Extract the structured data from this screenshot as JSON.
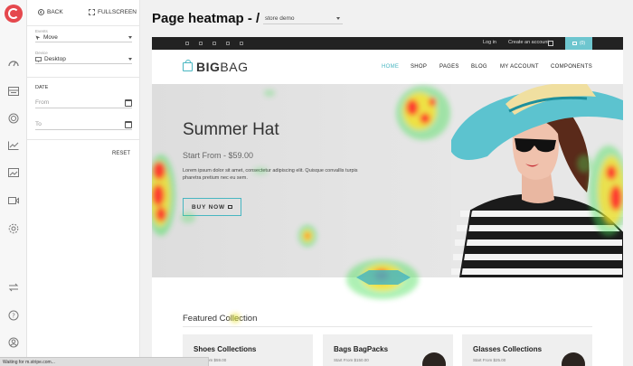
{
  "panel": {
    "back_label": "BACK",
    "fullscreen_label": "FULLSCREEN",
    "events": {
      "label": "Events",
      "value": "Move"
    },
    "device": {
      "label": "Device",
      "value": "Desktop"
    },
    "date_title": "DATE",
    "from_placeholder": "From",
    "to_placeholder": "To",
    "reset_label": "RESET"
  },
  "main": {
    "title": "Page heatmap - /",
    "page_select": "store demo"
  },
  "site": {
    "login": "Log in",
    "create_account": "Create an account",
    "cart_count": "(0)",
    "brand_bold": "BIG",
    "brand_rest": "BAG",
    "menu": [
      "HOME",
      "SHOP",
      "PAGES",
      "BLOG",
      "MY ACCOUNT",
      "COMPONENTS"
    ],
    "hero": {
      "title": "Summer Hat",
      "price": "Start From - $59.00",
      "desc": "Lorem ipsum dolor sit amet, consectetur adipiscing elit. Quisque convallis turpis pharetra pretium nec eu sem.",
      "button": "BUY NOW"
    },
    "featured": "Featured Collection",
    "cards": [
      {
        "title": "Shoes Collections",
        "price": "Start From $59.00"
      },
      {
        "title": "Bags BagPacks",
        "price": "Start From $150.00"
      },
      {
        "title": "Glasses Collections",
        "price": "Start From $25.00"
      }
    ]
  },
  "status": "Waiting for m.stripe.com...",
  "colors": {
    "accent": "#48b6c1",
    "brand_red": "#e5484d",
    "heat_hot": "#ff2a1a",
    "heat_warm": "#ffe020",
    "heat_cool": "#49e05a"
  },
  "icons": {
    "rail": [
      "dashboard-icon",
      "recordings-icon",
      "heatmaps-icon",
      "funnels-icon",
      "forms-icon",
      "video-icon",
      "settings-icon",
      "integrations-icon",
      "help-icon",
      "account-icon"
    ]
  }
}
